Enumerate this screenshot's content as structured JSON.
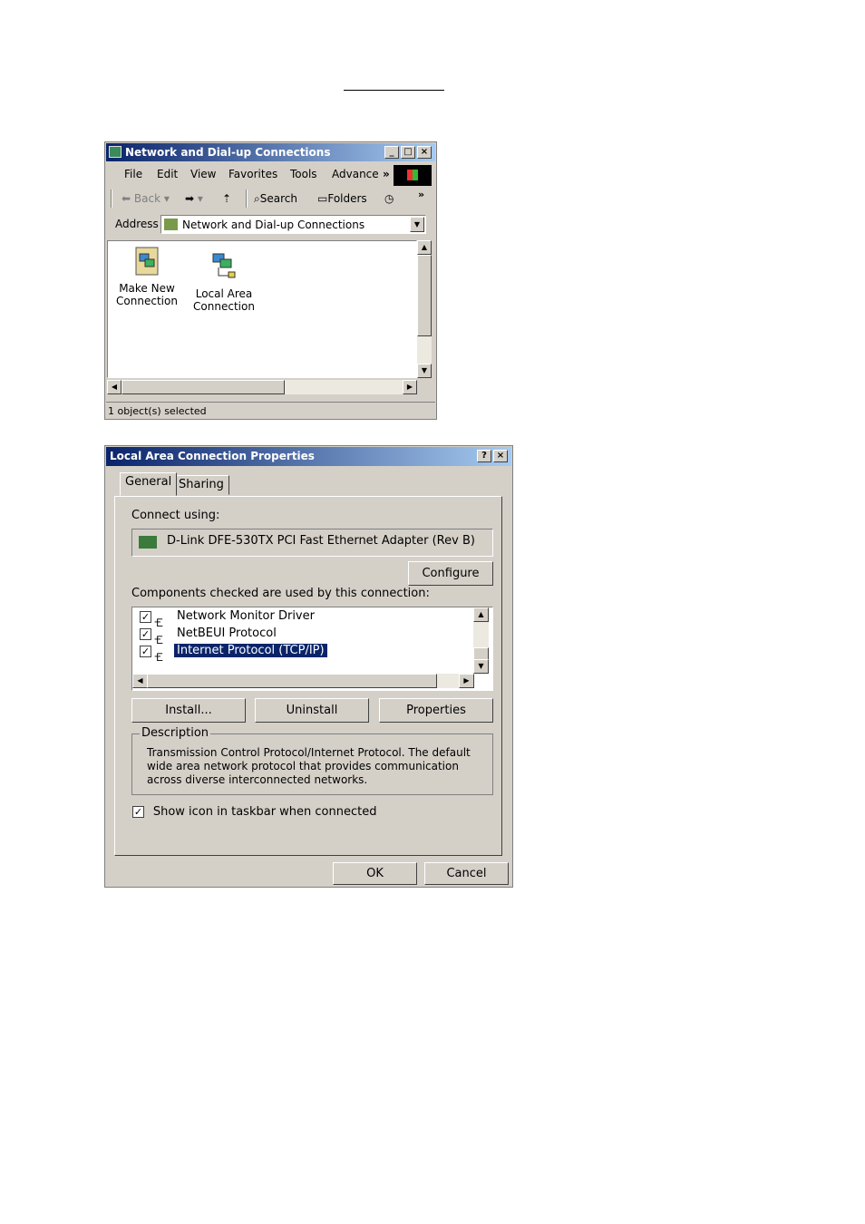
{
  "explorer": {
    "title": "Network and Dial-up Connections",
    "window_buttons": [
      "_",
      "□",
      "×"
    ],
    "menu": [
      "File",
      "Edit",
      "View",
      "Favorites",
      "Tools",
      "Advance"
    ],
    "menu_more": "»",
    "toolbar": {
      "back": "Back",
      "search": "Search",
      "folders": "Folders",
      "more": "»"
    },
    "address": {
      "label": "Address",
      "value": "Network and Dial-up Connections"
    },
    "items": [
      {
        "label1": "Make New",
        "label2": "Connection",
        "icon": "make-new-connection-icon"
      },
      {
        "label1": "Local Area",
        "label2": "Connection",
        "icon": "local-area-connection-icon"
      }
    ],
    "status": "1 object(s) selected"
  },
  "dialog": {
    "title": "Local Area Connection Properties",
    "title_buttons": [
      "?",
      "×"
    ],
    "tabs": [
      "General",
      "Sharing"
    ],
    "connect_using_label": "Connect using:",
    "adapter": "D-Link DFE-530TX PCI Fast Ethernet Adapter (Rev B)",
    "configure_label": "Configure",
    "components_label": "Components checked are used by this connection:",
    "components": [
      {
        "name": "Network Monitor Driver",
        "checked": true,
        "selected": false
      },
      {
        "name": "NetBEUI Protocol",
        "checked": true,
        "selected": false
      },
      {
        "name": "Internet Protocol (TCP/IP)",
        "checked": true,
        "selected": true
      }
    ],
    "buttons": {
      "install": "Install...",
      "uninstall": "Uninstall",
      "properties": "Properties",
      "ok": "OK",
      "cancel": "Cancel"
    },
    "description": {
      "legend": "Description",
      "text": "Transmission Control Protocol/Internet Protocol. The default wide area network protocol that provides communication across diverse interconnected networks."
    },
    "show_icon_label": "Show icon in taskbar when connected",
    "show_icon_checked": true
  },
  "colors": {
    "title_active": "#0a246a",
    "title_gradient_end": "#a6caf0",
    "face": "#d4d0c8",
    "selection": "#0a246a"
  }
}
